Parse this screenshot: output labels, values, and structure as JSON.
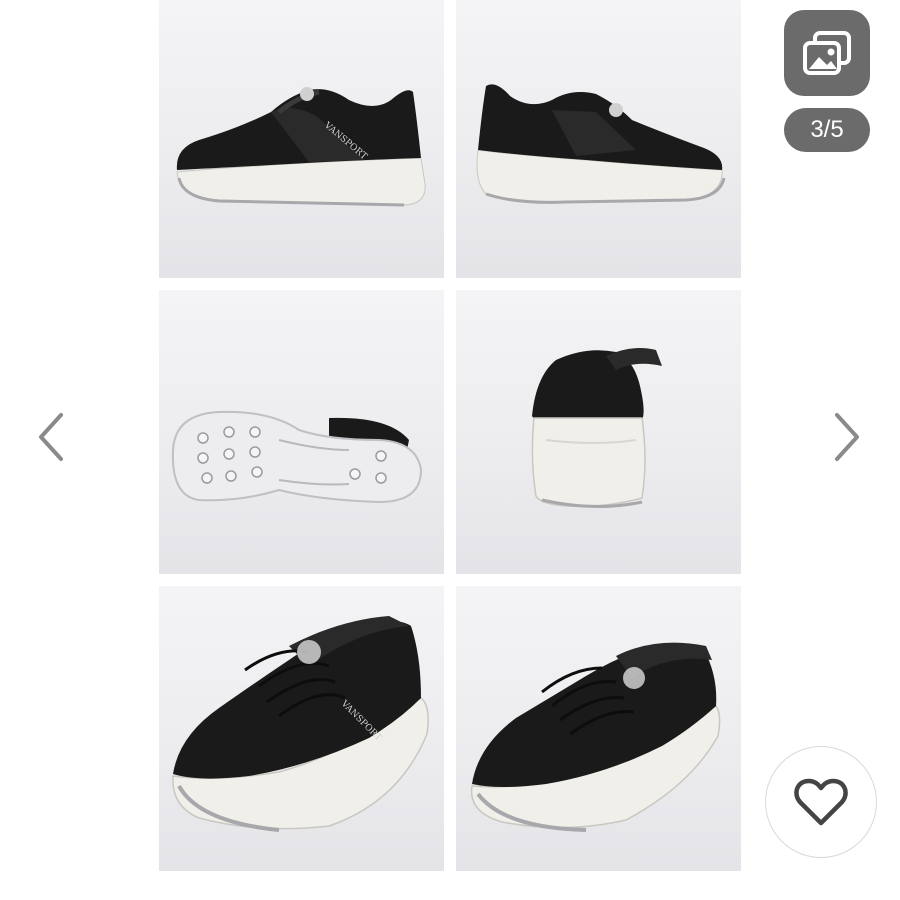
{
  "gallery": {
    "counter": "3/5",
    "photos": [
      {
        "name": "side-view-left"
      },
      {
        "name": "side-view-right"
      },
      {
        "name": "outsole-view"
      },
      {
        "name": "rear-view"
      },
      {
        "name": "three-quarter-front-left"
      },
      {
        "name": "three-quarter-front-right"
      }
    ],
    "brand_text": "VANSPORT"
  },
  "icons": {
    "prev": "chevron-left-icon",
    "next": "chevron-right-icon",
    "gallery": "image-stack-icon",
    "like": "heart-outline-icon"
  },
  "colors": {
    "overlay": "#6b6b6b",
    "arrow": "#8a8a8a",
    "shoe_upper": "#1a1a1a",
    "sole": "#f1efe9"
  }
}
